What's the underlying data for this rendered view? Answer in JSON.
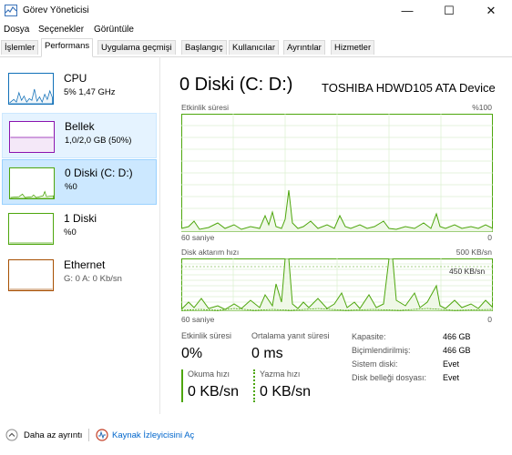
{
  "window": {
    "title": "Görev Yöneticisi",
    "minimize": "—",
    "maximize": "☐",
    "close": "✕"
  },
  "menu": {
    "file": "Dosya",
    "options": "Seçenekler",
    "view": "Görüntüle"
  },
  "tabs": [
    "İşlemler",
    "Performans",
    "Uygulama geçmişi",
    "Başlangıç",
    "Kullanıcılar",
    "Ayrıntılar",
    "Hizmetler"
  ],
  "sidebar": {
    "items": [
      {
        "title": "CPU",
        "sub": "5% 1,47 GHz",
        "color": "#1170b8"
      },
      {
        "title": "Bellek",
        "sub": "1,0/2,0 GB (50%)",
        "color": "#8b12ae"
      },
      {
        "title": "0 Diski (C: D:)",
        "sub": "%0",
        "color": "#4da60c"
      },
      {
        "title": "1 Diski",
        "sub": "%0",
        "color": "#4da60c"
      },
      {
        "title": "Ethernet",
        "sub": "G: 0 A: 0 Kb/sn",
        "color": "#a74f01"
      }
    ]
  },
  "main": {
    "title": "0 Diski (C: D:)",
    "device": "TOSHIBA HDWD105 ATA Device",
    "graph1": {
      "label": "Etkinlik süresi",
      "max": "%100",
      "time": "60 saniye",
      "min": "0"
    },
    "graph2": {
      "label": "Disk aktarım hızı",
      "max": "500 KB/sn",
      "inner_max": "450 KB/sn",
      "time": "60 saniye",
      "min": "0"
    },
    "stats": {
      "active_label": "Etkinlik süresi",
      "active_value": "0%",
      "resp_label": "Ortalama yanıt süresi",
      "resp_value": "0 ms",
      "read_label": "Okuma hızı",
      "read_value": "0 KB/sn",
      "write_label": "Yazma hızı",
      "write_value": "0 KB/sn"
    },
    "info": [
      {
        "key": "Kapasite:",
        "value": "466 GB"
      },
      {
        "key": "Biçimlendirilmiş:",
        "value": "466 GB"
      },
      {
        "key": "Sistem diski:",
        "value": "Evet"
      },
      {
        "key": "Disk belleği dosyası:",
        "value": "Evet"
      }
    ]
  },
  "footer": {
    "less_details": "Daha az ayrıntı",
    "resource_monitor": "Kaynak İzleyicisini Aç"
  },
  "colors": {
    "disk": "#4da60c",
    "disk_fill": "#eff8e7",
    "grid": "#dcefd0",
    "selected": "#cce8ff"
  }
}
